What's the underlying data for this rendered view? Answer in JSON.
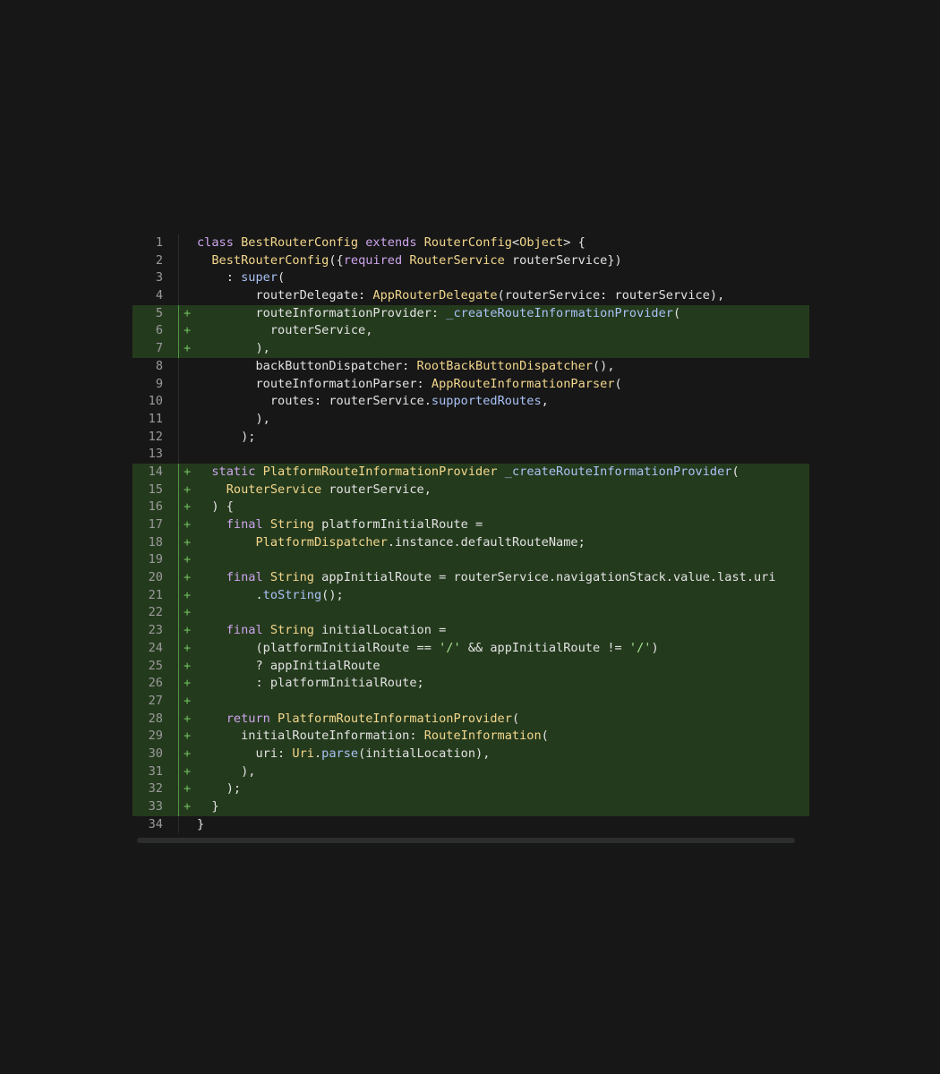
{
  "code_viewer": {
    "lines": [
      {
        "n": "1",
        "diff": "",
        "added": false,
        "tokens": [
          {
            "t": "class ",
            "c": "kw"
          },
          {
            "t": "BestRouterConfig",
            "c": "fn"
          },
          {
            "t": " extends ",
            "c": "kw"
          },
          {
            "t": "RouterConfig",
            "c": "fn"
          },
          {
            "t": "<",
            "c": "punc"
          },
          {
            "t": "Object",
            "c": "fn"
          },
          {
            "t": "> {",
            "c": "punc"
          }
        ]
      },
      {
        "n": "2",
        "diff": "",
        "added": false,
        "tokens": [
          {
            "t": "  ",
            "c": "plain"
          },
          {
            "t": "BestRouterConfig",
            "c": "fn"
          },
          {
            "t": "({",
            "c": "punc"
          },
          {
            "t": "required ",
            "c": "kw"
          },
          {
            "t": "RouterService",
            "c": "fn"
          },
          {
            "t": " routerService})",
            "c": "plain"
          }
        ]
      },
      {
        "n": "3",
        "diff": "",
        "added": false,
        "tokens": [
          {
            "t": "    : ",
            "c": "plain"
          },
          {
            "t": "super",
            "c": "mth"
          },
          {
            "t": "(",
            "c": "punc"
          }
        ]
      },
      {
        "n": "4",
        "diff": "",
        "added": false,
        "tokens": [
          {
            "t": "        routerDelegate: ",
            "c": "plain"
          },
          {
            "t": "AppRouterDelegate",
            "c": "fn"
          },
          {
            "t": "(routerService: routerService),",
            "c": "plain"
          }
        ]
      },
      {
        "n": "5",
        "diff": "+",
        "added": true,
        "tokens": [
          {
            "t": "        routeInformationProvider: ",
            "c": "plain"
          },
          {
            "t": "_createRouteInformationProvider",
            "c": "mth"
          },
          {
            "t": "(",
            "c": "punc"
          }
        ]
      },
      {
        "n": "6",
        "diff": "+",
        "added": true,
        "tokens": [
          {
            "t": "          routerService,",
            "c": "plain"
          }
        ]
      },
      {
        "n": "7",
        "diff": "+",
        "added": true,
        "tokens": [
          {
            "t": "        ),",
            "c": "plain"
          }
        ]
      },
      {
        "n": "8",
        "diff": "",
        "added": false,
        "tokens": [
          {
            "t": "        backButtonDispatcher: ",
            "c": "plain"
          },
          {
            "t": "RootBackButtonDispatcher",
            "c": "fn"
          },
          {
            "t": "(),",
            "c": "plain"
          }
        ]
      },
      {
        "n": "9",
        "diff": "",
        "added": false,
        "tokens": [
          {
            "t": "        routeInformationParser: ",
            "c": "plain"
          },
          {
            "t": "AppRouteInformationParser",
            "c": "fn"
          },
          {
            "t": "(",
            "c": "punc"
          }
        ]
      },
      {
        "n": "10",
        "diff": "",
        "added": false,
        "tokens": [
          {
            "t": "          routes: routerService.",
            "c": "plain"
          },
          {
            "t": "supportedRoutes",
            "c": "mth"
          },
          {
            "t": ",",
            "c": "punc"
          }
        ]
      },
      {
        "n": "11",
        "diff": "",
        "added": false,
        "tokens": [
          {
            "t": "        ),",
            "c": "plain"
          }
        ]
      },
      {
        "n": "12",
        "diff": "",
        "added": false,
        "tokens": [
          {
            "t": "      );",
            "c": "plain"
          }
        ]
      },
      {
        "n": "13",
        "diff": "",
        "added": false,
        "tokens": []
      },
      {
        "n": "14",
        "diff": "+",
        "added": true,
        "tokens": [
          {
            "t": "  static ",
            "c": "kw"
          },
          {
            "t": "PlatformRouteInformationProvider",
            "c": "fn"
          },
          {
            "t": " ",
            "c": "plain"
          },
          {
            "t": "_createRouteInformationProvider",
            "c": "mth"
          },
          {
            "t": "(",
            "c": "punc"
          }
        ]
      },
      {
        "n": "15",
        "diff": "+",
        "added": true,
        "tokens": [
          {
            "t": "    ",
            "c": "plain"
          },
          {
            "t": "RouterService",
            "c": "fn"
          },
          {
            "t": " routerService,",
            "c": "plain"
          }
        ]
      },
      {
        "n": "16",
        "diff": "+",
        "added": true,
        "tokens": [
          {
            "t": "  ) {",
            "c": "plain"
          }
        ]
      },
      {
        "n": "17",
        "diff": "+",
        "added": true,
        "tokens": [
          {
            "t": "    final ",
            "c": "kw"
          },
          {
            "t": "String",
            "c": "fn"
          },
          {
            "t": " platformInitialRoute =",
            "c": "plain"
          }
        ]
      },
      {
        "n": "18",
        "diff": "+",
        "added": true,
        "tokens": [
          {
            "t": "        ",
            "c": "plain"
          },
          {
            "t": "PlatformDispatcher",
            "c": "fn"
          },
          {
            "t": ".instance.defaultRouteName;",
            "c": "plain"
          }
        ]
      },
      {
        "n": "19",
        "diff": "+",
        "added": true,
        "tokens": []
      },
      {
        "n": "20",
        "diff": "+",
        "added": true,
        "tokens": [
          {
            "t": "    final ",
            "c": "kw"
          },
          {
            "t": "String",
            "c": "fn"
          },
          {
            "t": " appInitialRoute = routerService.navigationStack.value.last.uri",
            "c": "plain"
          }
        ]
      },
      {
        "n": "21",
        "diff": "+",
        "added": true,
        "tokens": [
          {
            "t": "        .",
            "c": "plain"
          },
          {
            "t": "toString",
            "c": "mth"
          },
          {
            "t": "();",
            "c": "plain"
          }
        ]
      },
      {
        "n": "22",
        "diff": "+",
        "added": true,
        "tokens": []
      },
      {
        "n": "23",
        "diff": "+",
        "added": true,
        "tokens": [
          {
            "t": "    final ",
            "c": "kw"
          },
          {
            "t": "String",
            "c": "fn"
          },
          {
            "t": " initialLocation =",
            "c": "plain"
          }
        ]
      },
      {
        "n": "24",
        "diff": "+",
        "added": true,
        "tokens": [
          {
            "t": "        (platformInitialRoute == ",
            "c": "plain"
          },
          {
            "t": "'/'",
            "c": "str"
          },
          {
            "t": " && appInitialRoute != ",
            "c": "plain"
          },
          {
            "t": "'/'",
            "c": "str"
          },
          {
            "t": ")",
            "c": "plain"
          }
        ]
      },
      {
        "n": "25",
        "diff": "+",
        "added": true,
        "tokens": [
          {
            "t": "        ? appInitialRoute",
            "c": "plain"
          }
        ]
      },
      {
        "n": "26",
        "diff": "+",
        "added": true,
        "tokens": [
          {
            "t": "        : platformInitialRoute;",
            "c": "plain"
          }
        ]
      },
      {
        "n": "27",
        "diff": "+",
        "added": true,
        "tokens": []
      },
      {
        "n": "28",
        "diff": "+",
        "added": true,
        "tokens": [
          {
            "t": "    return ",
            "c": "kw"
          },
          {
            "t": "PlatformRouteInformationProvider",
            "c": "fn"
          },
          {
            "t": "(",
            "c": "punc"
          }
        ]
      },
      {
        "n": "29",
        "diff": "+",
        "added": true,
        "tokens": [
          {
            "t": "      initialRouteInformation: ",
            "c": "plain"
          },
          {
            "t": "RouteInformation",
            "c": "fn"
          },
          {
            "t": "(",
            "c": "punc"
          }
        ]
      },
      {
        "n": "30",
        "diff": "+",
        "added": true,
        "tokens": [
          {
            "t": "        uri: ",
            "c": "plain"
          },
          {
            "t": "Uri",
            "c": "fn"
          },
          {
            "t": ".",
            "c": "plain"
          },
          {
            "t": "parse",
            "c": "mth"
          },
          {
            "t": "(initialLocation),",
            "c": "plain"
          }
        ]
      },
      {
        "n": "31",
        "diff": "+",
        "added": true,
        "tokens": [
          {
            "t": "      ),",
            "c": "plain"
          }
        ]
      },
      {
        "n": "32",
        "diff": "+",
        "added": true,
        "tokens": [
          {
            "t": "    );",
            "c": "plain"
          }
        ]
      },
      {
        "n": "33",
        "diff": "+",
        "added": true,
        "tokens": [
          {
            "t": "  }",
            "c": "plain"
          }
        ]
      },
      {
        "n": "34",
        "diff": "",
        "added": false,
        "tokens": [
          {
            "t": "}",
            "c": "plain"
          }
        ]
      }
    ]
  }
}
